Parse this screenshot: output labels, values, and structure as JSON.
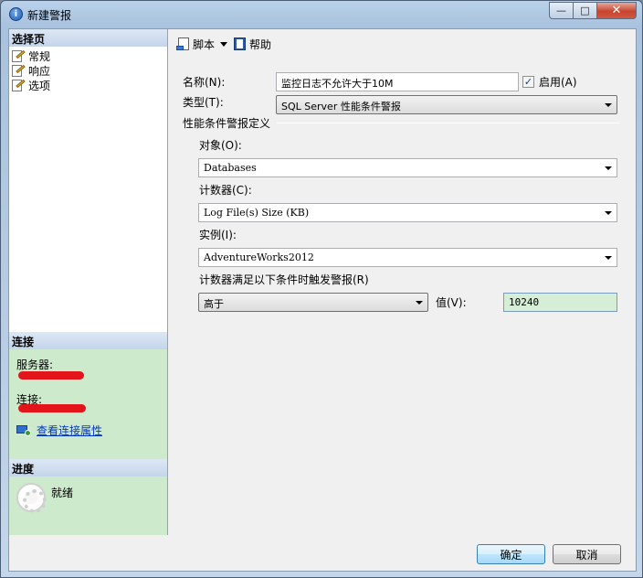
{
  "window": {
    "title": "新建警报",
    "close_glyph": "✕",
    "minimize_glyph": "—",
    "maximize_glyph": "□"
  },
  "left": {
    "select_page_header": "选择页",
    "pages": [
      {
        "label": "常规",
        "icon": "page-edit-icon"
      },
      {
        "label": "响应",
        "icon": "page-edit-icon"
      },
      {
        "label": "选项",
        "icon": "page-edit-icon"
      }
    ],
    "connection_header": "连接",
    "server_label": "服务器:",
    "connection_label": "连接:",
    "view_connection_link": "查看连接属性",
    "progress_header": "进度",
    "progress_status": "就绪"
  },
  "toolbar": {
    "script_label": "脚本",
    "help_label": "帮助"
  },
  "form": {
    "name_label": "名称(N):",
    "name_value": "监控日志不允许大于10M",
    "enable_label": "启用(A)",
    "enable_checked": true,
    "type_label": "类型(T):",
    "type_value": "SQL Server 性能条件警报",
    "definition_group": "性能条件警报定义",
    "object_label": "对象(O):",
    "object_value": "Databases",
    "counter_label": "计数器(C):",
    "counter_value": "Log File(s) Size (KB)",
    "instance_label": "实例(I):",
    "instance_value": "AdventureWorks2012",
    "condition_label": "计数器满足以下条件时触发警报(R)",
    "condition_value": "高于",
    "value_label": "值(V):",
    "value_value": "10240"
  },
  "footer": {
    "ok_label": "确定",
    "cancel_label": "取消"
  }
}
